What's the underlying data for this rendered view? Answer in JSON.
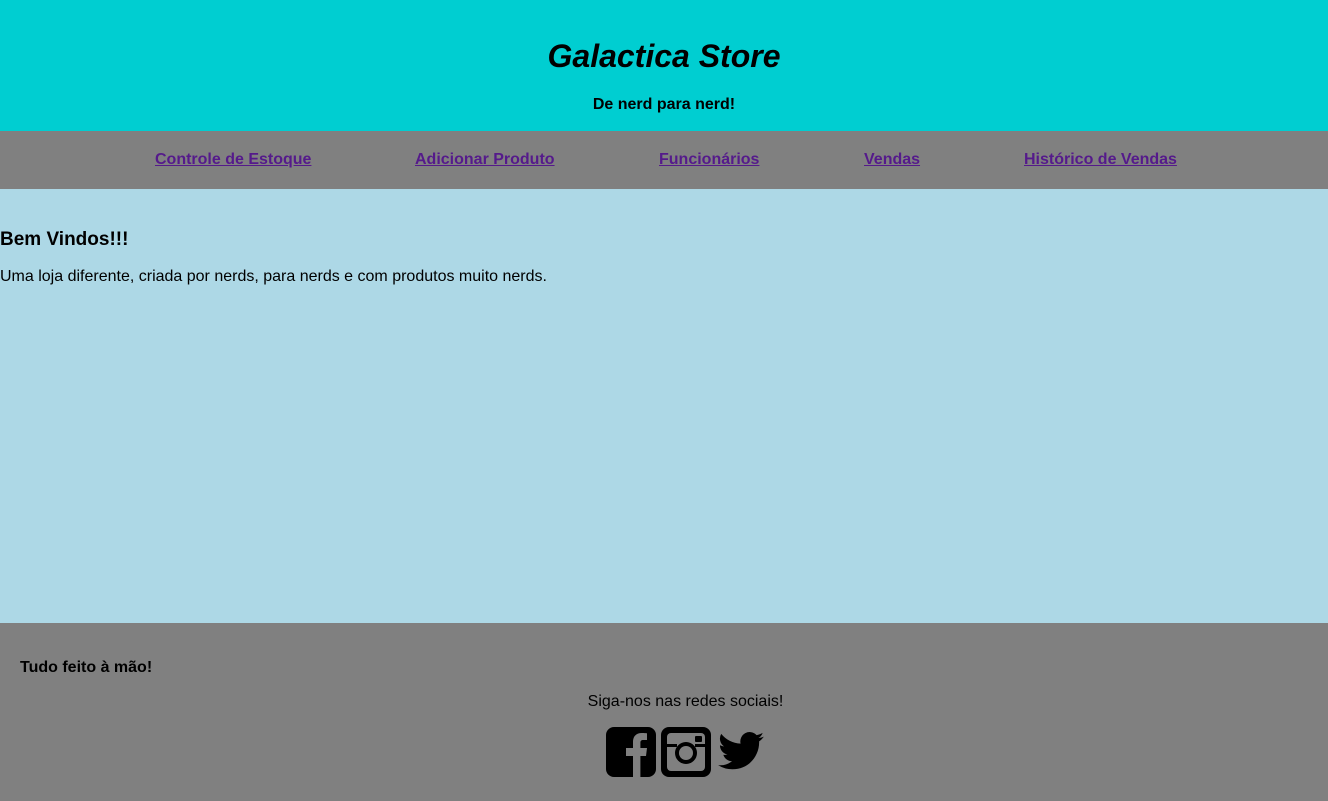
{
  "header": {
    "title": "Galactica Store",
    "subtitle": "De nerd para nerd!",
    "background": "#00CED1"
  },
  "nav": {
    "items": [
      {
        "label": "Controle de Estoque"
      },
      {
        "label": "Adicionar Produto"
      },
      {
        "label": "Funcionários"
      },
      {
        "label": "Vendas"
      },
      {
        "label": "Histórico de Vendas"
      }
    ],
    "link_color": "#551A8B"
  },
  "main": {
    "heading": "Bem Vindos!!!",
    "text": "Uma loja diferente, criada por nerds, para nerds e com produtos muito nerds.",
    "background": "#ADD8E6"
  },
  "footer": {
    "tagline": "Tudo feito à mão!",
    "follow": "Siga-nos nas redes sociais!",
    "social": [
      {
        "icon": "facebook-icon"
      },
      {
        "icon": "instagram-icon"
      },
      {
        "icon": "twitter-icon"
      }
    ],
    "background": "#808080"
  }
}
